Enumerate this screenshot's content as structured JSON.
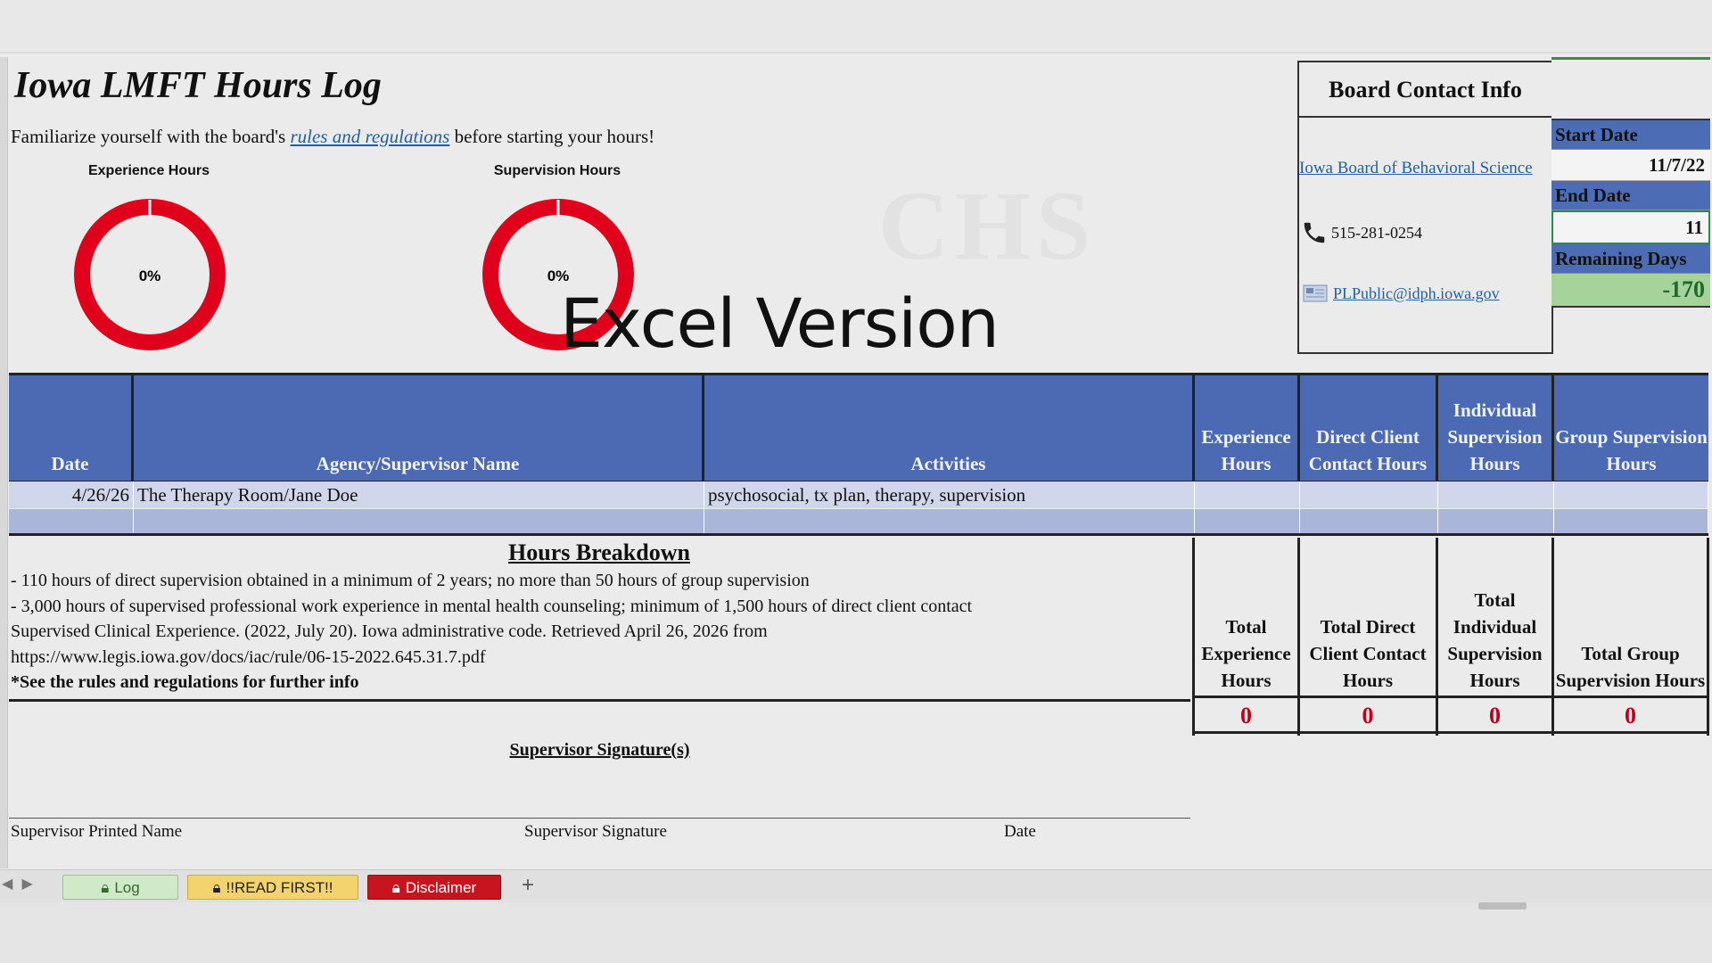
{
  "sheet": {
    "title": "Iowa LMFT Hours Log",
    "intro_before": "Familiarize yourself with the board's ",
    "intro_link": "rules and regulations",
    "intro_after": " before starting your hours!",
    "watermark": "Excel Version"
  },
  "gauges": [
    {
      "label": "Experience Hours",
      "value": "0%",
      "fraction": 0,
      "color": "#e0001b"
    },
    {
      "label": "Supervision Hours",
      "value": "0%",
      "fraction": 0,
      "color": "#e0001b"
    }
  ],
  "contact": {
    "title": "Board Contact Info",
    "board_link": "Iowa Board of Behavioral Science",
    "phone": "515-281-0254",
    "email": "PLPublic@idph.iowa.gov"
  },
  "dates": {
    "start_label": "Start Date",
    "start_value": "11/7/22",
    "end_label": "End Date",
    "end_value": "11",
    "remaining_label": "Remaining Days",
    "remaining_value": "-170"
  },
  "table": {
    "headers": [
      "Date",
      "Agency/Supervisor Name",
      "Activities",
      "Experience Hours",
      "Direct Client Contact Hours",
      "Individual Supervision Hours",
      "Group Supervision Hours"
    ],
    "rows": [
      [
        "4/26/26",
        "The Therapy Room/Jane Doe",
        "psychosocial, tx plan, therapy, supervision",
        "",
        "",
        "",
        ""
      ],
      [
        "",
        "",
        "",
        "",
        "",
        "",
        ""
      ]
    ]
  },
  "breakdown": {
    "title": "Hours Breakdown",
    "lines": [
      "- 110 hours of direct supervision obtained in a minimum of 2 years; no more than 50 hours of group supervision",
      "- 3,000 hours of supervised professional work experience in mental health counseling; minimum of 1,500 hours of direct client contact",
      "Supervised Clinical Experience. (2022, July 20). Iowa administrative code. Retrieved April 26, 2026 from",
      "https://www.legis.iowa.gov/docs/iac/rule/06-15-2022.645.31.7.pdf"
    ],
    "note": "*See the rules and regulations for further info"
  },
  "totals": [
    {
      "label": "Total Experience Hours",
      "value": "0"
    },
    {
      "label": "Total Direct Client Contact Hours",
      "value": "0"
    },
    {
      "label": "Total Individual Supervision Hours",
      "value": "0"
    },
    {
      "label": "Total Group Supervision Hours",
      "value": "0"
    }
  ],
  "signature": {
    "title": "Supervisor Signature(s)",
    "printed_name": "Supervisor Printed Name",
    "signature": "Supervisor Signature",
    "date": "Date"
  },
  "tabs": [
    {
      "label": "Log",
      "color": "#cfe9c9"
    },
    {
      "label": "!!READ FIRST!!",
      "color": "#f2d36e"
    },
    {
      "label": "Disclaimer",
      "color": "#c8141e"
    }
  ],
  "add_sheet": "+"
}
